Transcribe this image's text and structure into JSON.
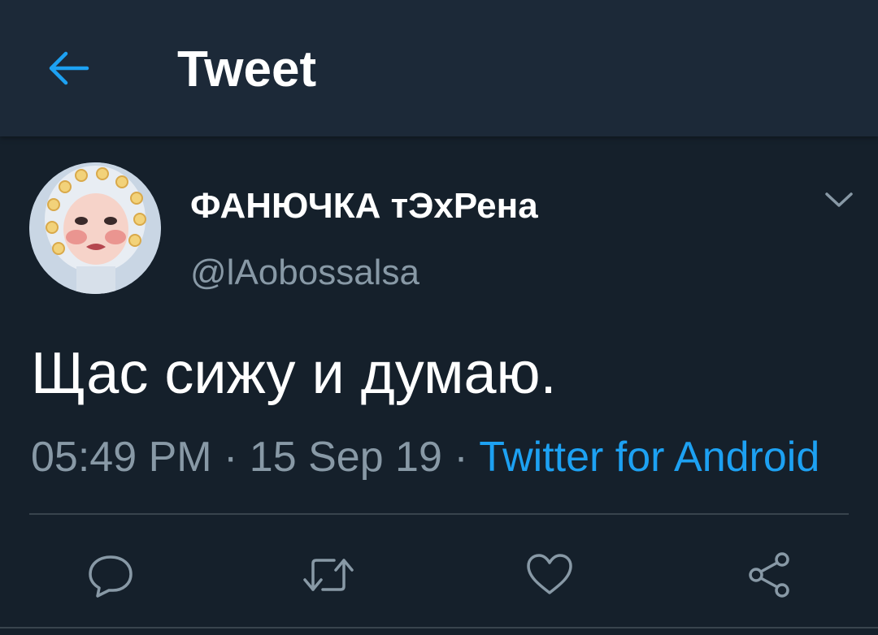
{
  "header": {
    "title": "Tweet",
    "back_icon": "arrow-left-icon"
  },
  "tweet": {
    "display_name": "ФАНЮЧКА тЭхРена",
    "handle": "@lAobossalsa",
    "text": "Щас сижу и думаю.",
    "time": "05:49 PM",
    "separator": " · ",
    "date": "15 Sep 19",
    "source": "Twitter for Android"
  },
  "actions": {
    "reply_icon": "reply-icon",
    "retweet_icon": "retweet-icon",
    "like_icon": "heart-icon",
    "share_icon": "share-icon"
  },
  "colors": {
    "background": "#15202b",
    "header": "#1c2938",
    "accent": "#1da1f2",
    "secondary_text": "#8899a6",
    "divider": "#38444d"
  }
}
